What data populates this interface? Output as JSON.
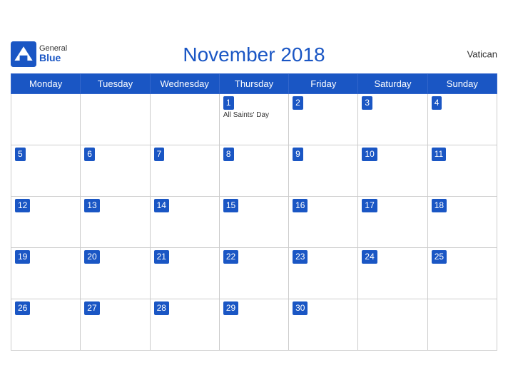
{
  "header": {
    "title": "November 2018",
    "country": "Vatican",
    "logo": {
      "general": "General",
      "blue": "Blue"
    }
  },
  "weekdays": [
    "Monday",
    "Tuesday",
    "Wednesday",
    "Thursday",
    "Friday",
    "Saturday",
    "Sunday"
  ],
  "weeks": [
    [
      {
        "day": "",
        "holiday": ""
      },
      {
        "day": "",
        "holiday": ""
      },
      {
        "day": "",
        "holiday": ""
      },
      {
        "day": "1",
        "holiday": "All Saints' Day"
      },
      {
        "day": "2",
        "holiday": ""
      },
      {
        "day": "3",
        "holiday": ""
      },
      {
        "day": "4",
        "holiday": ""
      }
    ],
    [
      {
        "day": "5",
        "holiday": ""
      },
      {
        "day": "6",
        "holiday": ""
      },
      {
        "day": "7",
        "holiday": ""
      },
      {
        "day": "8",
        "holiday": ""
      },
      {
        "day": "9",
        "holiday": ""
      },
      {
        "day": "10",
        "holiday": ""
      },
      {
        "day": "11",
        "holiday": ""
      }
    ],
    [
      {
        "day": "12",
        "holiday": ""
      },
      {
        "day": "13",
        "holiday": ""
      },
      {
        "day": "14",
        "holiday": ""
      },
      {
        "day": "15",
        "holiday": ""
      },
      {
        "day": "16",
        "holiday": ""
      },
      {
        "day": "17",
        "holiday": ""
      },
      {
        "day": "18",
        "holiday": ""
      }
    ],
    [
      {
        "day": "19",
        "holiday": ""
      },
      {
        "day": "20",
        "holiday": ""
      },
      {
        "day": "21",
        "holiday": ""
      },
      {
        "day": "22",
        "holiday": ""
      },
      {
        "day": "23",
        "holiday": ""
      },
      {
        "day": "24",
        "holiday": ""
      },
      {
        "day": "25",
        "holiday": ""
      }
    ],
    [
      {
        "day": "26",
        "holiday": ""
      },
      {
        "day": "27",
        "holiday": ""
      },
      {
        "day": "28",
        "holiday": ""
      },
      {
        "day": "29",
        "holiday": ""
      },
      {
        "day": "30",
        "holiday": ""
      },
      {
        "day": "",
        "holiday": ""
      },
      {
        "day": "",
        "holiday": ""
      }
    ]
  ]
}
